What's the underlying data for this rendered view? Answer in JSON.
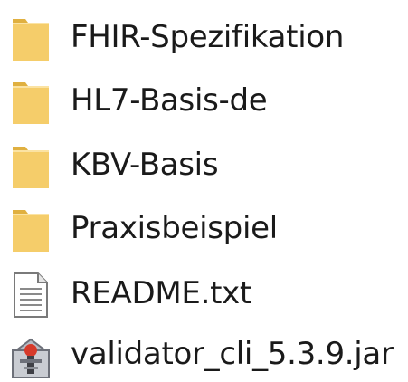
{
  "files": [
    {
      "name": "FHIR-Spezifikation",
      "icon": "folder-icon",
      "type": "folder"
    },
    {
      "name": "HL7-Basis-de",
      "icon": "folder-icon",
      "type": "folder"
    },
    {
      "name": "KBV-Basis",
      "icon": "folder-icon",
      "type": "folder"
    },
    {
      "name": "Praxisbeispiel",
      "icon": "folder-icon",
      "type": "folder"
    },
    {
      "name": "README.txt",
      "icon": "text-file-icon",
      "type": "text"
    },
    {
      "name": "validator_cli_5.3.9.jar",
      "icon": "java-jar-icon",
      "type": "jar"
    }
  ],
  "colors": {
    "folder": "#f5cd6a",
    "folder_dark": "#e0b040",
    "text": "#1a1a1a"
  }
}
